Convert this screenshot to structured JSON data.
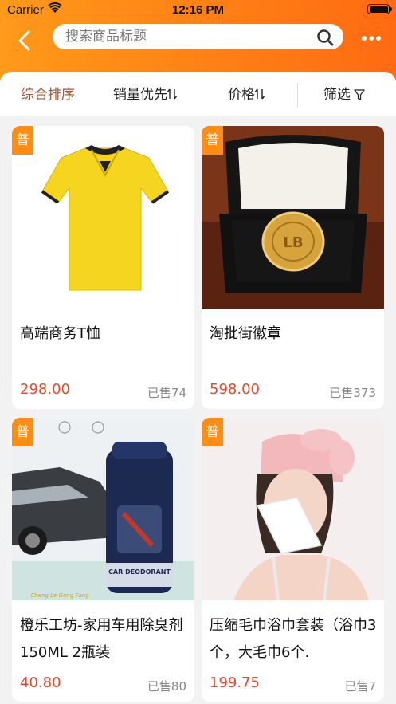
{
  "status_bar": {
    "carrier": "Carrier",
    "time": "12:16 PM"
  },
  "search": {
    "placeholder": "搜索商品标题"
  },
  "filters": {
    "sort_label": "综合排序",
    "sales_label": "销量优先",
    "price_label": "价格",
    "filter_label": "筛选"
  },
  "colors": {
    "header_start": "#ff9a1a",
    "header_end": "#ff6a12",
    "price": "#e8492e",
    "tag": "#ff8c14",
    "active_tab": "#a05a3a"
  },
  "products": [
    {
      "tag": "普",
      "title": "高端商务T恤",
      "price": "298.00",
      "sold": "已售74",
      "image": "yellow-polo-shirt"
    },
    {
      "tag": "普",
      "title": "淘批街徽章",
      "price": "598.00",
      "sold": "已售373",
      "image": "gold-badge-in-box"
    },
    {
      "tag": "普",
      "title": "橙乐工坊-家用车用除臭剂150ML 2瓶装",
      "price": "40.80",
      "sold": "已售80",
      "image": "car-deodorant-can"
    },
    {
      "tag": "普",
      "title": "压缩毛巾浴巾套装（浴巾3个，大毛巾6个.",
      "price": "199.75",
      "sold": "已售7",
      "image": "woman-with-towel"
    }
  ]
}
